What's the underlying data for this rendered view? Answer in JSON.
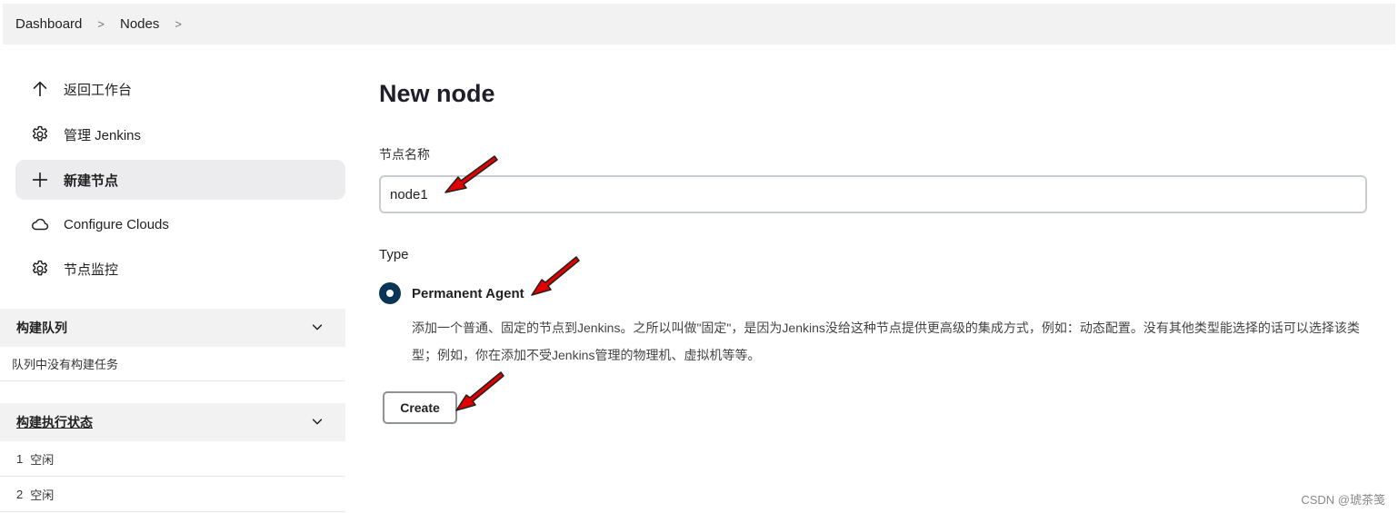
{
  "breadcrumb": {
    "items": [
      "Dashboard",
      "Nodes"
    ],
    "separator": ">"
  },
  "sidebar": {
    "tasks": [
      {
        "label": "返回工作台",
        "icon": "arrow-up-icon"
      },
      {
        "label": "管理 Jenkins",
        "icon": "gear-icon"
      },
      {
        "label": "新建节点",
        "icon": "plus-icon",
        "active": true
      },
      {
        "label": "Configure Clouds",
        "icon": "cloud-icon"
      },
      {
        "label": "节点监控",
        "icon": "gear-icon"
      }
    ],
    "build_queue": {
      "title": "构建队列",
      "empty_text": "队列中没有构建任务"
    },
    "executor_status": {
      "title": "构建执行状态",
      "executors": [
        {
          "number": "1",
          "status": "空闲"
        },
        {
          "number": "2",
          "status": "空闲"
        }
      ]
    }
  },
  "main": {
    "title": "New node",
    "name_label": "节点名称",
    "name_value": "node1",
    "type_label": "Type",
    "type_option": {
      "label": "Permanent Agent",
      "selected": true,
      "description": "添加一个普通、固定的节点到Jenkins。之所以叫做\"固定\"，是因为Jenkins没给这种节点提供更高级的集成方式，例如：动态配置。没有其他类型能选择的话可以选择该类型；例如，你在添加不受Jenkins管理的物理机、虚拟机等等。"
    },
    "create_label": "Create"
  },
  "watermark": "CSDN @琥茶笺",
  "colors": {
    "radio_selected": "#0b3556",
    "annotation_arrow": "#e00000",
    "panel_bg": "#f2f2f3"
  }
}
